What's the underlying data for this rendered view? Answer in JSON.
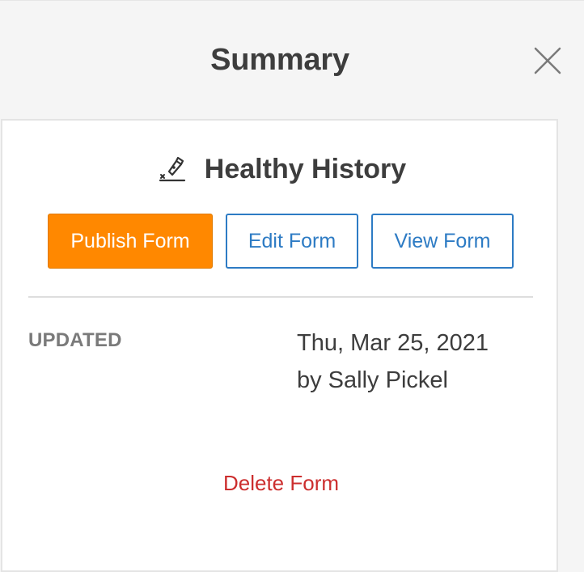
{
  "header": {
    "title": "Summary",
    "close_icon": "close-icon"
  },
  "form": {
    "icon": "pen-icon",
    "title": "Healthy History"
  },
  "actions": {
    "publish_label": "Publish Form",
    "edit_label": "Edit Form",
    "view_label": "View Form"
  },
  "details": {
    "updated_label": "UPDATED",
    "updated_date": "Thu, Mar 25, 2021",
    "updated_by": "by Sally Pickel"
  },
  "delete_label": "Delete Form",
  "colors": {
    "publish_bg": "#ff8800",
    "link_blue": "#2d7bc4",
    "delete_red": "#cc2e2e"
  }
}
